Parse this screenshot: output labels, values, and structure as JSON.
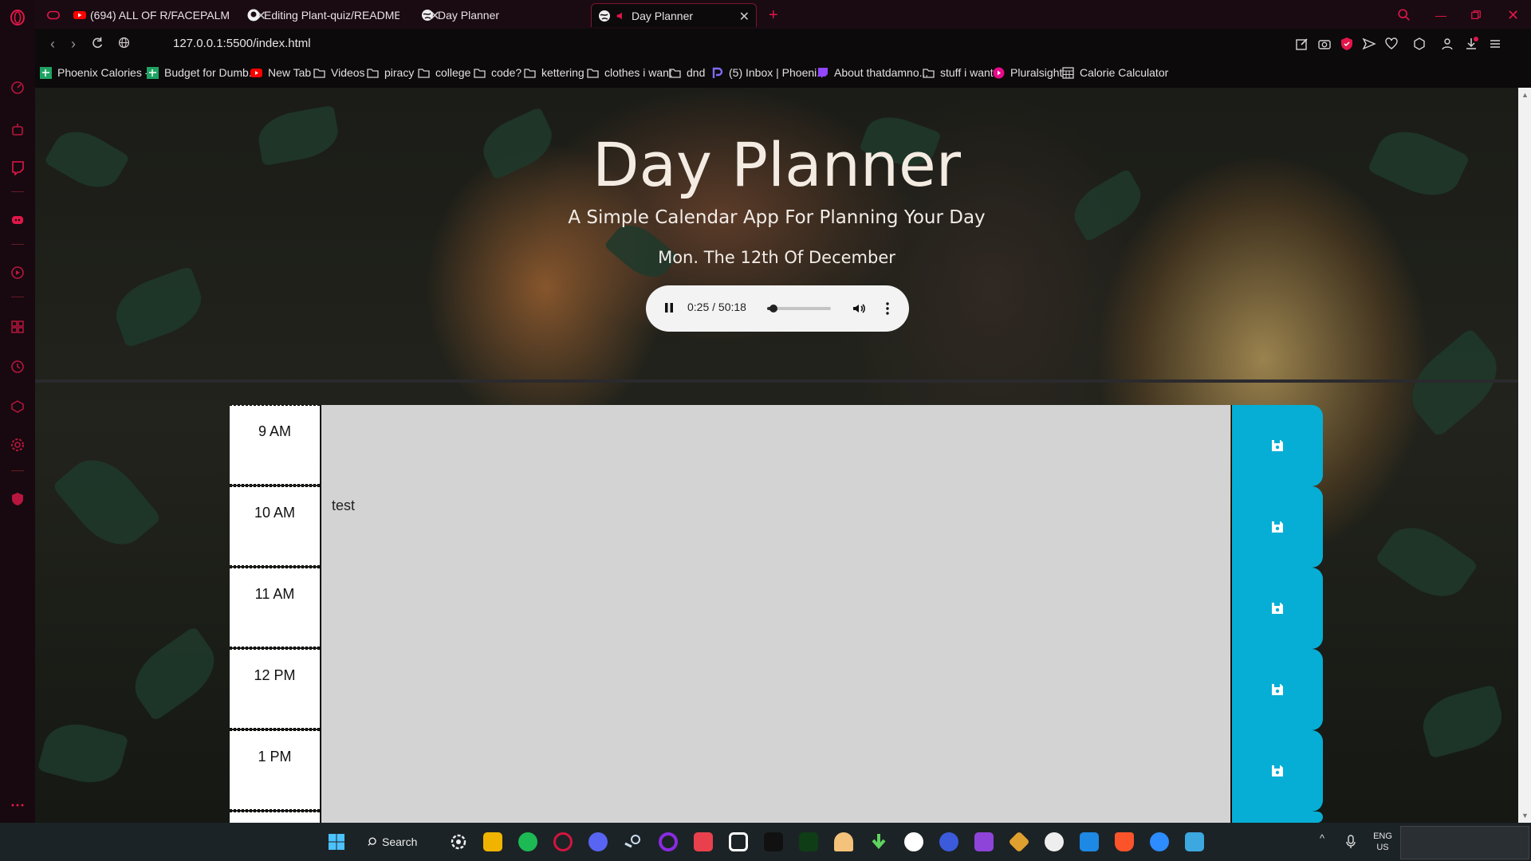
{
  "browser": {
    "tabs": [
      {
        "label": "(694) ALL OF R/FACEPALM",
        "icon": "youtube-icon",
        "active": false
      },
      {
        "label": "Editing Plant-quiz/README",
        "icon": "github-icon",
        "active": false
      },
      {
        "label": "Day Planner",
        "icon": "globe-icon",
        "active": false
      },
      {
        "label": "Day Planner",
        "icon": "globe-icon",
        "active": true
      }
    ],
    "url": "127.0.0.1:5500/index.html",
    "bookmarks": [
      {
        "label": "Phoenix Calories -...",
        "icon": "sheets-icon"
      },
      {
        "label": "Budget for Dumb...",
        "icon": "sheets-icon"
      },
      {
        "label": "New Tab",
        "icon": "youtube-icon"
      },
      {
        "label": "Videos",
        "icon": "folder-icon"
      },
      {
        "label": "piracy",
        "icon": "folder-icon"
      },
      {
        "label": "college",
        "icon": "folder-icon"
      },
      {
        "label": "code?",
        "icon": "folder-icon"
      },
      {
        "label": "kettering",
        "icon": "folder-icon"
      },
      {
        "label": "clothes i want",
        "icon": "folder-icon"
      },
      {
        "label": "dnd",
        "icon": "folder-icon"
      },
      {
        "label": "(5) Inbox | Phoeni...",
        "icon": "proton-icon"
      },
      {
        "label": "About thatdamno...",
        "icon": "twitch-icon"
      },
      {
        "label": "stuff i want",
        "icon": "folder-icon"
      },
      {
        "label": "Pluralsight",
        "icon": "pluralsight-icon"
      },
      {
        "label": "Calorie Calculator",
        "icon": "calculator-icon"
      }
    ],
    "accent": "#e2164a"
  },
  "app": {
    "title": "Day Planner",
    "subtitle": "A Simple Calendar App For Planning Your Day",
    "date": "Mon. The 12th Of December",
    "audio": {
      "current": "0:25",
      "duration": "50:18",
      "progress": 0.008
    },
    "rows": [
      {
        "hour": "9 AM",
        "text": ""
      },
      {
        "hour": "10 AM",
        "text": "test"
      },
      {
        "hour": "11 AM",
        "text": ""
      },
      {
        "hour": "12 PM",
        "text": ""
      },
      {
        "hour": "1 PM",
        "text": ""
      }
    ],
    "colors": {
      "save": "#06aed5",
      "textarea": "#d3d3d3"
    }
  },
  "taskbar": {
    "search_label": "Search",
    "lang_top": "ENG",
    "lang_bottom": "US"
  }
}
